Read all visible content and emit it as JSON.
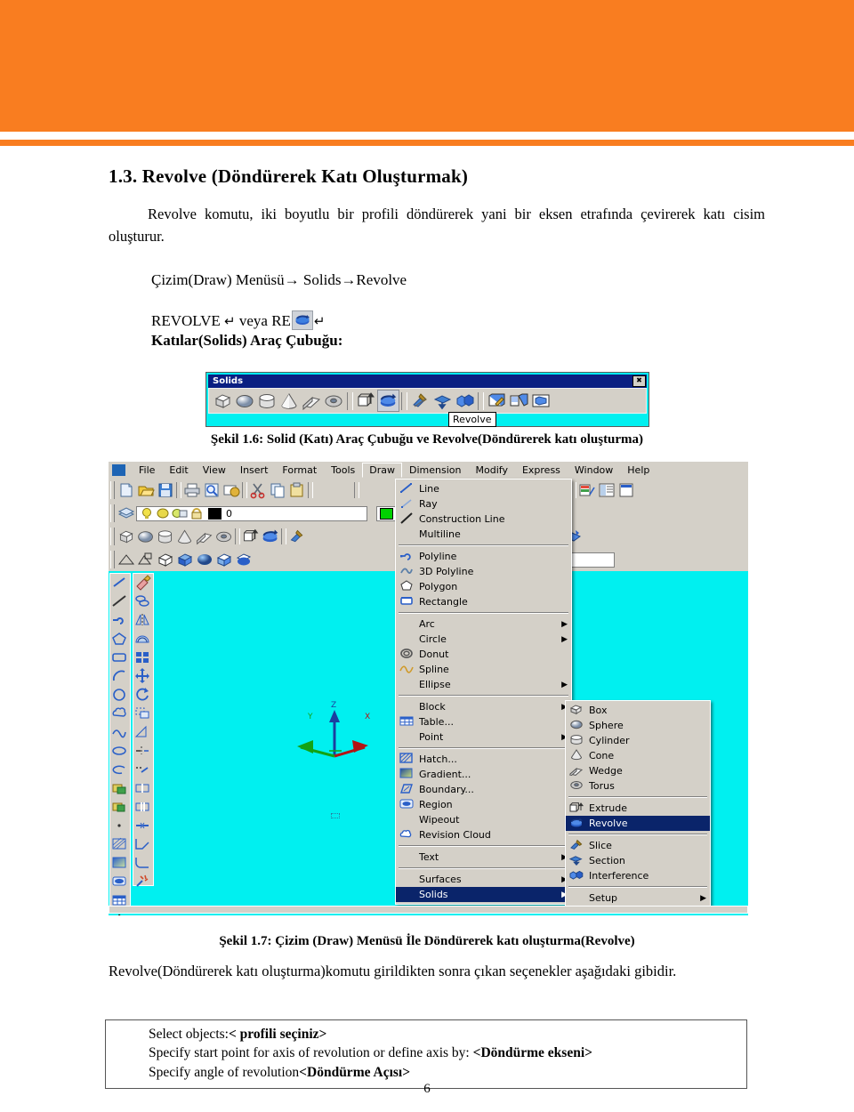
{
  "theme": {
    "banner_color": "#f97d20",
    "canvas_color": "#00f0f0",
    "ui_face": "#d4d0c8",
    "highlight": "#0a246a"
  },
  "document": {
    "heading": "1.3. Revolve (Döndürerek Katı Oluşturmak)",
    "intro": "Revolve komutu, iki boyutlu bir profili döndürerek yani bir eksen etrafında çevirerek katı cisim oluşturur.",
    "menu_path": "Çizim(Draw) Menüsü→ Solids→Revolve",
    "command_line_prefix": "REVOLVE",
    "command_return": "↵",
    "command_or": "veya",
    "command_alias": "RE",
    "command_return2": "↵",
    "toolbar_label": "Katılar(Solids) Araç Çubuğu:",
    "figure_16_caption": "Şekil 1.6: Solid (Katı) Araç Çubuğu ve Revolve(Döndürerek katı oluşturma)",
    "figure_17_caption": "Şekil 1.7: Çizim (Draw) Menüsü İle Döndürerek katı oluşturma(Revolve)",
    "closing_paragraph": "Revolve(Döndürerek katı oluşturma)komutu girildikten sonra çıkan seçenekler aşağıdaki gibidir.",
    "page_number": "6"
  },
  "prompt_box": {
    "lines": [
      {
        "plain": "Select objects:",
        "bold": "< profili seçiniz>"
      },
      {
        "plain": "Specify start point for axis of revolution or define axis by: ",
        "bold": "<Döndürme ekseni>"
      },
      {
        "plain": "Specify angle of revolution",
        "bold": "<Döndürme Açısı>"
      }
    ]
  },
  "solids_toolbar": {
    "title": "Solids",
    "close_glyph": "✖",
    "tooltip": "Revolve",
    "buttons": [
      {
        "name": "box-icon",
        "selected": false
      },
      {
        "name": "sphere-icon",
        "selected": false
      },
      {
        "name": "cylinder-icon",
        "selected": false
      },
      {
        "name": "cone-icon",
        "selected": false
      },
      {
        "name": "wedge-icon",
        "selected": false
      },
      {
        "name": "torus-icon",
        "selected": false
      },
      {
        "name": "separator",
        "selected": false
      },
      {
        "name": "extrude-icon",
        "selected": false
      },
      {
        "name": "revolve-icon",
        "selected": true
      },
      {
        "name": "separator",
        "selected": false
      },
      {
        "name": "slice-icon",
        "selected": false
      },
      {
        "name": "section-icon",
        "selected": false
      },
      {
        "name": "interference-icon",
        "selected": false
      },
      {
        "name": "separator",
        "selected": false
      },
      {
        "name": "setup-drawing-icon",
        "selected": false
      },
      {
        "name": "setup-view-icon",
        "selected": false
      },
      {
        "name": "setup-profile-icon",
        "selected": false
      }
    ]
  },
  "autocad": {
    "menubar": [
      "File",
      "Edit",
      "View",
      "Insert",
      "Format",
      "Tools",
      "Draw",
      "Dimension",
      "Modify",
      "Express",
      "Window",
      "Help"
    ],
    "active_menu": "Draw",
    "layer_value": "0",
    "color_value": "Green",
    "draw_menu": [
      {
        "label": "Line",
        "icon": "line-icon",
        "submenu": false,
        "separator_after": false
      },
      {
        "label": "Ray",
        "icon": "ray-icon",
        "submenu": false,
        "separator_after": false
      },
      {
        "label": "Construction Line",
        "icon": "construction-line-icon",
        "submenu": false,
        "separator_after": false
      },
      {
        "label": "Multiline",
        "icon": "none",
        "submenu": false,
        "separator_after": true
      },
      {
        "label": "Polyline",
        "icon": "polyline-icon",
        "submenu": false,
        "separator_after": false
      },
      {
        "label": "3D Polyline",
        "icon": "polyline-3d-icon",
        "submenu": false,
        "separator_after": false
      },
      {
        "label": "Polygon",
        "icon": "polygon-icon",
        "submenu": false,
        "separator_after": false
      },
      {
        "label": "Rectangle",
        "icon": "rectangle-icon",
        "submenu": false,
        "separator_after": true
      },
      {
        "label": "Arc",
        "icon": "none",
        "submenu": true,
        "separator_after": false
      },
      {
        "label": "Circle",
        "icon": "none",
        "submenu": true,
        "separator_after": false
      },
      {
        "label": "Donut",
        "icon": "donut-icon",
        "submenu": false,
        "separator_after": false
      },
      {
        "label": "Spline",
        "icon": "spline-icon",
        "submenu": false,
        "separator_after": false
      },
      {
        "label": "Ellipse",
        "icon": "none",
        "submenu": true,
        "separator_after": true
      },
      {
        "label": "Block",
        "icon": "none",
        "submenu": true,
        "separator_after": false
      },
      {
        "label": "Table...",
        "icon": "table-icon",
        "submenu": false,
        "separator_after": false
      },
      {
        "label": "Point",
        "icon": "none",
        "submenu": true,
        "separator_after": true
      },
      {
        "label": "Hatch...",
        "icon": "hatch-icon",
        "submenu": false,
        "separator_after": false
      },
      {
        "label": "Gradient...",
        "icon": "gradient-icon",
        "submenu": false,
        "separator_after": false
      },
      {
        "label": "Boundary...",
        "icon": "boundary-icon",
        "submenu": false,
        "separator_after": false
      },
      {
        "label": "Region",
        "icon": "region-icon",
        "submenu": false,
        "separator_after": false
      },
      {
        "label": "Wipeout",
        "icon": "none",
        "submenu": false,
        "separator_after": false
      },
      {
        "label": "Revision Cloud",
        "icon": "revision-cloud-icon",
        "submenu": false,
        "separator_after": true
      },
      {
        "label": "Text",
        "icon": "none",
        "submenu": true,
        "separator_after": true
      },
      {
        "label": "Surfaces",
        "icon": "none",
        "submenu": true,
        "separator_after": false
      },
      {
        "label": "Solids",
        "icon": "none",
        "submenu": true,
        "separator_after": false,
        "highlighted": true
      }
    ],
    "solids_menu": [
      {
        "label": "Box",
        "icon": "box-icon",
        "submenu": false,
        "separator_after": false
      },
      {
        "label": "Sphere",
        "icon": "sphere-icon",
        "submenu": false,
        "separator_after": false
      },
      {
        "label": "Cylinder",
        "icon": "cylinder-icon",
        "submenu": false,
        "separator_after": false
      },
      {
        "label": "Cone",
        "icon": "cone-icon",
        "submenu": false,
        "separator_after": false
      },
      {
        "label": "Wedge",
        "icon": "wedge-icon",
        "submenu": false,
        "separator_after": false
      },
      {
        "label": "Torus",
        "icon": "torus-icon",
        "submenu": false,
        "separator_after": true
      },
      {
        "label": "Extrude",
        "icon": "extrude-icon",
        "submenu": false,
        "separator_after": false
      },
      {
        "label": "Revolve",
        "icon": "revolve-icon",
        "submenu": false,
        "separator_after": true,
        "highlighted": true
      },
      {
        "label": "Slice",
        "icon": "slice-icon",
        "submenu": false,
        "separator_after": false
      },
      {
        "label": "Section",
        "icon": "section-icon",
        "submenu": false,
        "separator_after": false
      },
      {
        "label": "Interference",
        "icon": "interference-icon",
        "submenu": false,
        "separator_after": true
      },
      {
        "label": "Setup",
        "icon": "none",
        "submenu": true,
        "separator_after": false
      }
    ],
    "ucs_axes": [
      "Z",
      "X",
      "Y"
    ]
  }
}
